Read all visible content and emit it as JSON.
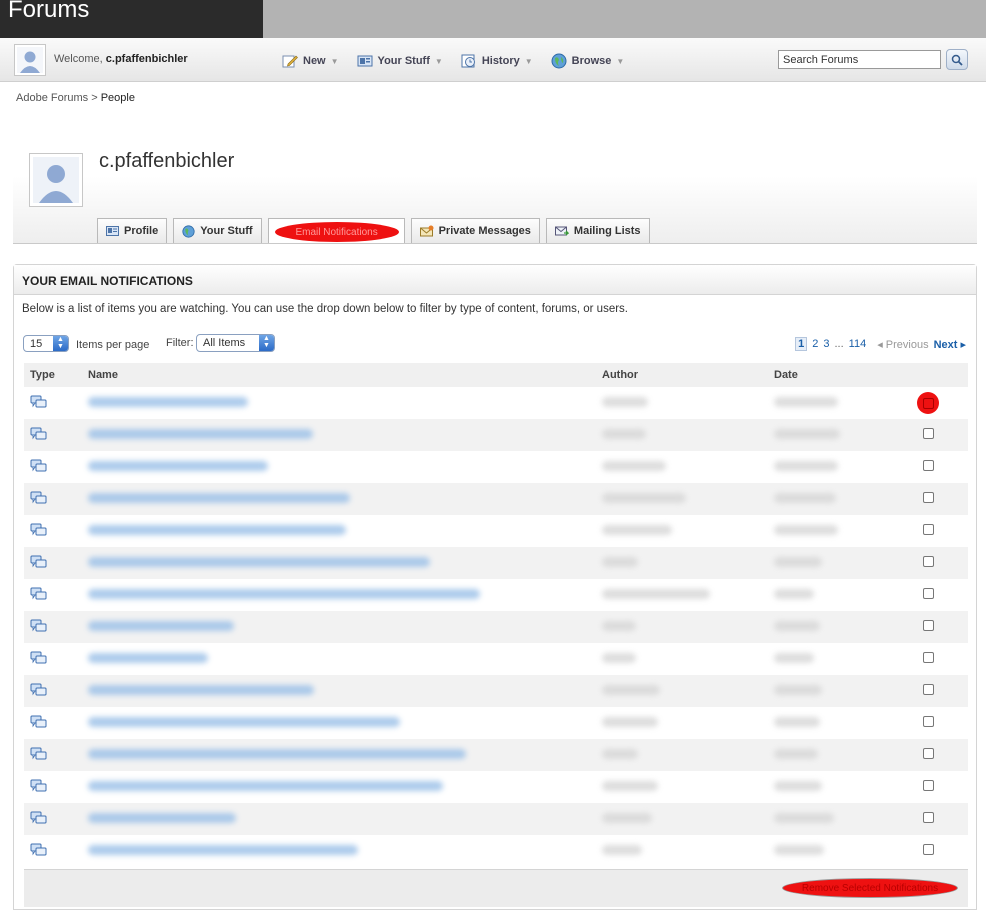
{
  "brand": {
    "title": "Forums"
  },
  "userbar": {
    "welcome_prefix": "Welcome, ",
    "username": "c.pfaffenbichler",
    "nav": [
      {
        "label": "New",
        "icon": "pencil-icon"
      },
      {
        "label": "Your Stuff",
        "icon": "stuff-icon"
      },
      {
        "label": "History",
        "icon": "history-icon"
      },
      {
        "label": "Browse",
        "icon": "globe-icon"
      }
    ],
    "search_placeholder": "Search Forums"
  },
  "breadcrumb": {
    "root": "Adobe Forums",
    "sep": ">",
    "current": "People"
  },
  "profile": {
    "name": "c.pfaffenbichler",
    "tabs": [
      {
        "label": "Profile",
        "icon": "profile-icon"
      },
      {
        "label": "Your Stuff",
        "icon": "globe-icon"
      },
      {
        "label": "Email Notifications",
        "icon": "email-icon",
        "active": true
      },
      {
        "label": "Private Messages",
        "icon": "envelope-icon"
      },
      {
        "label": "Mailing Lists",
        "icon": "mailing-icon"
      }
    ]
  },
  "panel": {
    "title": "YOUR EMAIL NOTIFICATIONS",
    "description": "Below is a list of items you are watching. You can use the drop down below to filter by type of content, forums, or users.",
    "per_page_value": "15",
    "per_page_label": "Items per page",
    "filter_label": "Filter:",
    "filter_value": "All Items",
    "pager": {
      "pages": [
        "1",
        "2",
        "3"
      ],
      "dots": "...",
      "last": "114",
      "prev": "Previous",
      "next": "Next"
    },
    "columns": [
      "Type",
      "Name",
      "Author",
      "Date"
    ],
    "row_count": 15,
    "remove_label": "Remove Selected Notifications"
  }
}
